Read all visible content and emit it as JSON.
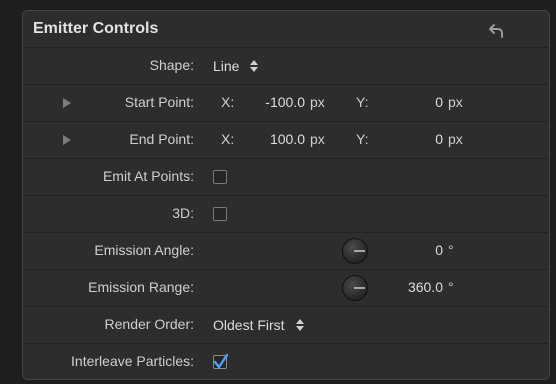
{
  "panel": {
    "title": "Emitter Controls"
  },
  "shape": {
    "label": "Shape:",
    "value": "Line"
  },
  "start_point": {
    "label": "Start Point:",
    "x_label": "X:",
    "x_value": "-100.0",
    "x_unit": "px",
    "y_label": "Y:",
    "y_value": "0",
    "y_unit": "px"
  },
  "end_point": {
    "label": "End Point:",
    "x_label": "X:",
    "x_value": "100.0",
    "x_unit": "px",
    "y_label": "Y:",
    "y_value": "0",
    "y_unit": "px"
  },
  "emit_at_points": {
    "label": "Emit At Points:",
    "checked": false
  },
  "three_d": {
    "label": "3D:",
    "checked": false
  },
  "emission_angle": {
    "label": "Emission Angle:",
    "value": "0",
    "unit": "°"
  },
  "emission_range": {
    "label": "Emission Range:",
    "value": "360.0",
    "unit": "°"
  },
  "render_order": {
    "label": "Render Order:",
    "value": "Oldest First"
  },
  "interleave_particles": {
    "label": "Interleave Particles:",
    "checked": true
  },
  "colors": {
    "panel_bg": "#2d2d2d",
    "accent_check": "#4aa3ff"
  },
  "icons": {
    "reset": "reset-arrow-icon",
    "disclosure": "disclosure-triangle-icon",
    "popup": "popup-arrows-icon",
    "dial": "dial-icon"
  }
}
